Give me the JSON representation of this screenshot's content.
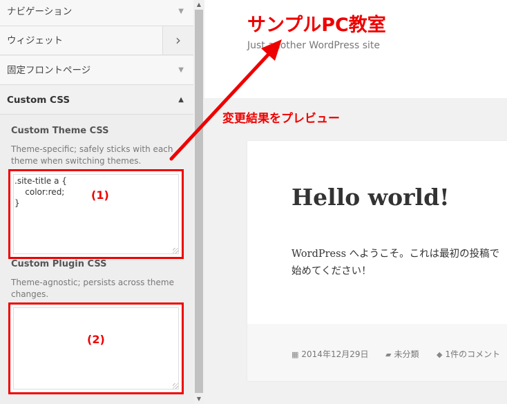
{
  "sidebar": {
    "sections": [
      {
        "label": "ナビゲーション"
      },
      {
        "label": "ウィジェット"
      },
      {
        "label": "固定フロントページ"
      },
      {
        "label": "Custom CSS"
      }
    ],
    "theme_css": {
      "label": "Custom Theme CSS",
      "description": "Theme-specific; safely sticks with each theme when switching themes.",
      "code": ".site-title a {\n    color:red;\n}",
      "annotation": "(1)"
    },
    "plugin_css": {
      "label": "Custom Plugin CSS",
      "description": "Theme-agnostic; persists across theme changes.",
      "code": "",
      "annotation": "(2)"
    }
  },
  "preview": {
    "site_title": "サンプルPC教室",
    "site_description": "Just another WordPress site",
    "annotation": "変更結果をプレビュー",
    "post": {
      "title": "Hello world!",
      "body_line1": "WordPress へようこそ。これは最初の投稿で",
      "body_line2": "始めてください！",
      "date": "2014年12月29日",
      "category": "未分類",
      "comments": "1件のコメント"
    }
  },
  "colors": {
    "accent_red": "#ee0000"
  },
  "icons": {
    "date": "calendar-icon",
    "category": "folder-icon",
    "comments": "comment-icon"
  }
}
